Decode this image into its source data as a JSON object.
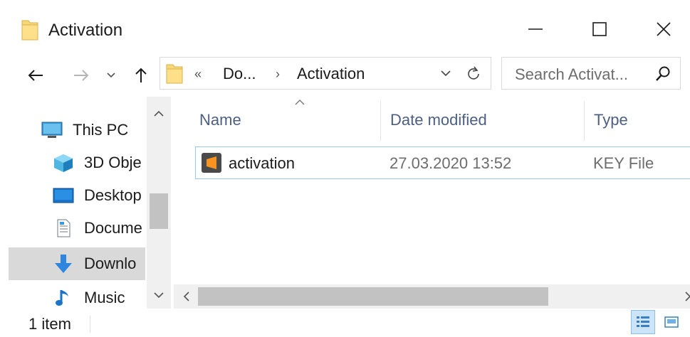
{
  "window": {
    "title": "Activation",
    "icon": "folder-icon",
    "controls": {
      "minimize": "minimize-icon",
      "maximize": "maximize-icon",
      "close": "close-icon"
    }
  },
  "nav": {
    "back_icon": "back-arrow-icon",
    "forward_icon": "forward-arrow-icon",
    "recent_icon": "chevron-down-icon",
    "up_icon": "up-arrow-icon"
  },
  "address": {
    "overflow": "«",
    "crumbs": [
      "Do...",
      "Activation"
    ],
    "separator": "›"
  },
  "search": {
    "placeholder": "Search Activat..."
  },
  "sidebar": {
    "items": [
      {
        "label": "This PC",
        "icon": "this-pc-icon"
      },
      {
        "label": "3D Obje",
        "icon": "3d-objects-icon"
      },
      {
        "label": "Desktop",
        "icon": "desktop-icon"
      },
      {
        "label": "Docume",
        "icon": "documents-icon"
      },
      {
        "label": "Downlo",
        "icon": "downloads-icon",
        "selected": true
      },
      {
        "label": "Music",
        "icon": "music-icon"
      }
    ]
  },
  "columns": {
    "name": "Name",
    "date": "Date modified",
    "type": "Type"
  },
  "files": [
    {
      "name": "activation",
      "date": "27.03.2020 13:52",
      "type": "KEY File",
      "icon": "sublime-text-icon"
    }
  ],
  "status": {
    "count": "1 item"
  },
  "colors": {
    "selection_bg": "#d9d9d9",
    "header_text": "#4d6082",
    "row_border": "#99c9ef",
    "folder_yellow": "#f8d775"
  }
}
